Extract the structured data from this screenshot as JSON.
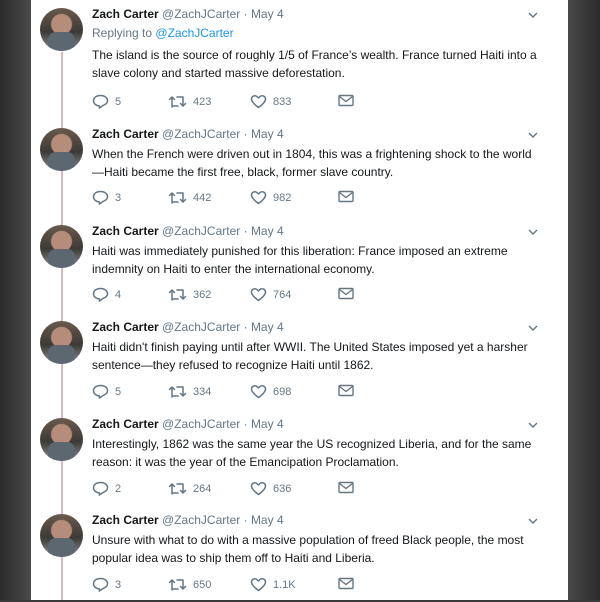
{
  "thread": {
    "tweets": [
      {
        "name": "Zach Carter",
        "handle": "@ZachJCarter",
        "date": "May 4",
        "replying_to_label": "Replying to",
        "replying_to_mention": "@ZachJCarter",
        "text": "The island is the source of roughly 1/5 of France’s wealth. France turned Haiti into a slave colony and started massive deforestation.",
        "replies": "5",
        "retweets": "423",
        "likes": "833"
      },
      {
        "name": "Zach Carter",
        "handle": "@ZachJCarter",
        "date": "May 4",
        "text": "When the French were driven out in 1804, this was a frightening shock to the world—Haiti became the first free, black, former slave country.",
        "replies": "3",
        "retweets": "442",
        "likes": "982"
      },
      {
        "name": "Zach Carter",
        "handle": "@ZachJCarter",
        "date": "May 4",
        "text": "Haiti was immediately punished for this liberation: France imposed an extreme indemnity on Haiti to enter the international economy.",
        "replies": "4",
        "retweets": "362",
        "likes": "764"
      },
      {
        "name": "Zach Carter",
        "handle": "@ZachJCarter",
        "date": "May 4",
        "text": "Haiti didn't finish paying until after WWII. The United States imposed yet a harsher sentence—they refused to recognize Haiti until 1862.",
        "replies": "5",
        "retweets": "334",
        "likes": "698"
      },
      {
        "name": "Zach Carter",
        "handle": "@ZachJCarter",
        "date": "May 4",
        "text": "Interestingly, 1862 was the same year the US recognized Liberia, and for the same reason: it was the year of the Emancipation Proclamation.",
        "replies": "2",
        "retweets": "264",
        "likes": "636"
      },
      {
        "name": "Zach Carter",
        "handle": "@ZachJCarter",
        "date": "May 4",
        "text": "Unsure with what to do with a massive population of freed Black people, the most popular idea was to ship them off to Haiti and Liberia.",
        "replies": "3",
        "retweets": "650",
        "likes": "1.1K"
      }
    ],
    "dot": "·",
    "colors": {
      "thread_line": "#d9b7c1",
      "name": "#14171a",
      "meta": "#657786",
      "link": "#1b95e0"
    },
    "icons": [
      "reply-icon",
      "retweet-icon",
      "like-icon",
      "direct-message-icon",
      "chevron-down-icon"
    ]
  }
}
